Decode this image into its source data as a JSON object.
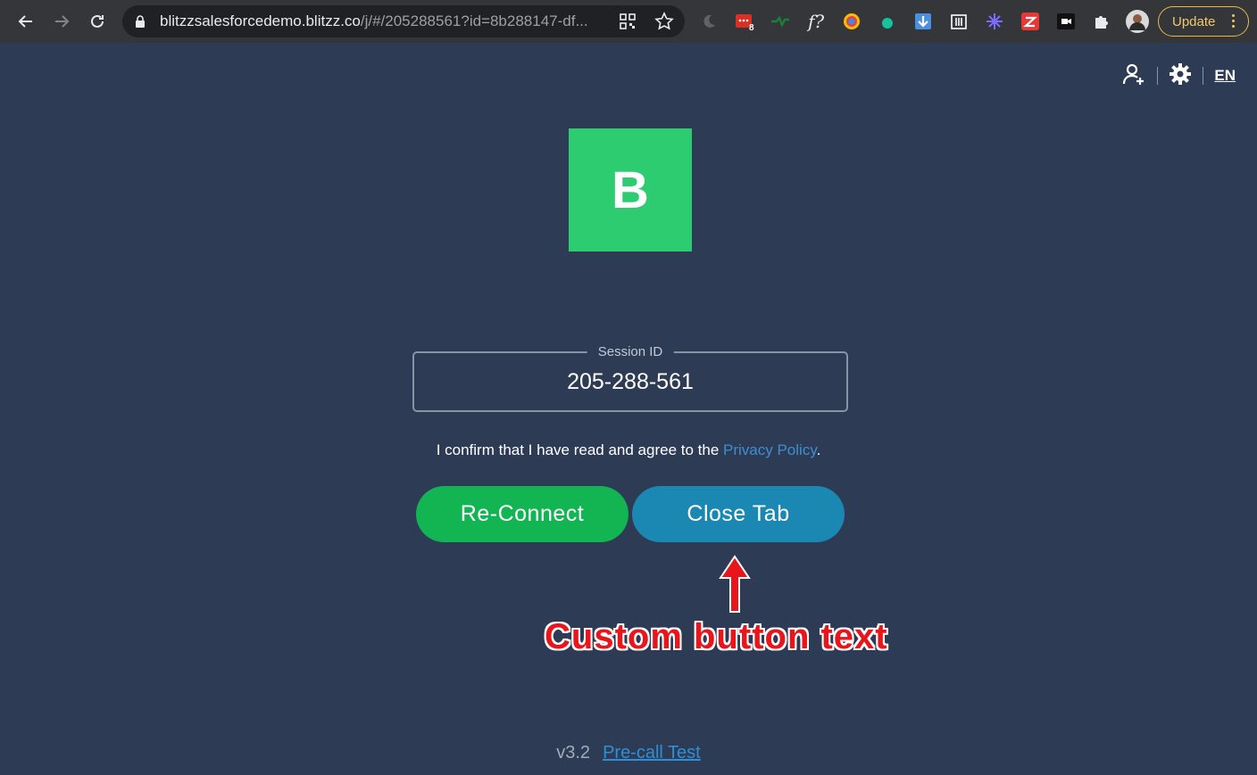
{
  "browser": {
    "url_host": "blitzzsalesforcedemo.blitzz.co",
    "url_rest": "/j/#/205288561?id=8b288147-df...",
    "extension_badge": "8",
    "ext_f_label": "f?",
    "update_label": "Update"
  },
  "header": {
    "language": "EN"
  },
  "logo": {
    "letter": "B",
    "color": "#2ecc71"
  },
  "session": {
    "label": "Session ID",
    "value": "205-288-561"
  },
  "consent": {
    "text": "I confirm that I have read and agree to the ",
    "link": "Privacy Policy",
    "suffix": "."
  },
  "buttons": {
    "reconnect": "Re-Connect",
    "close_tab": "Close Tab"
  },
  "annotation": {
    "text": "Custom button text",
    "color": "#e8161b"
  },
  "footer": {
    "version": "v3.2",
    "precall_link": "Pre-call Test"
  },
  "colors": {
    "background": "#2e3b55",
    "reconnect": "#13b553",
    "close_tab": "#1b87b3"
  },
  "icons": [
    "back-icon",
    "forward-icon",
    "reload-icon",
    "lock-icon",
    "qr-icon",
    "star-icon",
    "add-user-icon",
    "settings-gear-icon"
  ]
}
